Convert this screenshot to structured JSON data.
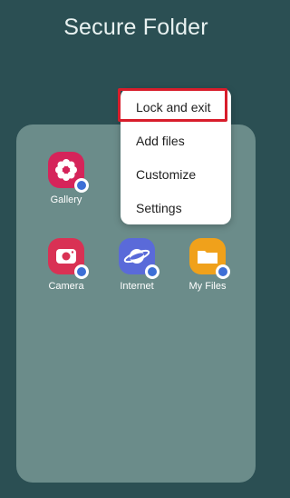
{
  "header": {
    "title": "Secure Folder"
  },
  "apps": [
    {
      "label": "Gallery",
      "color": "#d5245a",
      "icon": "gallery-flower-icon"
    },
    {
      "label": "Camera",
      "color": "#d93154",
      "icon": "camera-icon"
    },
    {
      "label": "Internet",
      "color": "#5a6ad9",
      "icon": "internet-planet-icon"
    },
    {
      "label": "My Files",
      "color": "#f0a11b",
      "icon": "folder-icon"
    }
  ],
  "menu": {
    "items": [
      {
        "label": "Lock and exit",
        "highlighted": true
      },
      {
        "label": "Add files"
      },
      {
        "label": "Customize"
      },
      {
        "label": "Settings"
      }
    ]
  },
  "colors": {
    "background": "#2b4f53",
    "panel": "#6b8c8a",
    "highlight_border": "#d81d2b"
  }
}
